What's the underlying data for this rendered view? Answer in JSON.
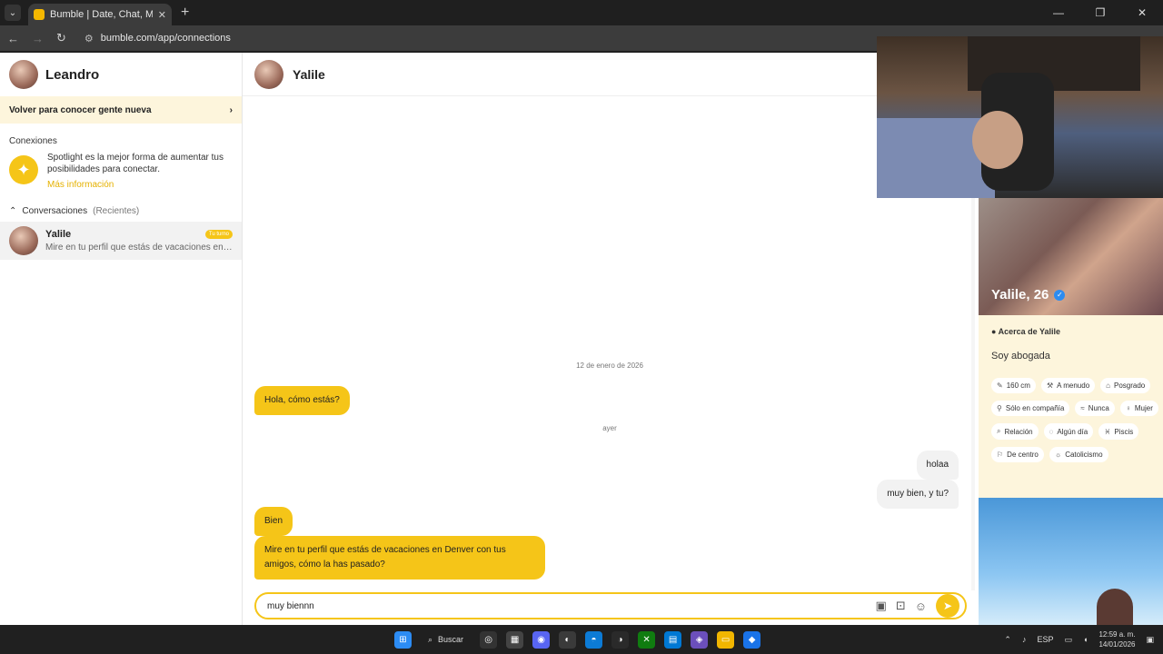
{
  "browser": {
    "tab_title": "Bumble | Date, Chat, Meet New",
    "url": "bumble.com/app/connections"
  },
  "sidebar": {
    "username": "Leandro",
    "meet_new_label": "Volver para conocer gente nueva",
    "connections_label": "Conexiones",
    "spotlight_text": "Spotlight es la mejor forma de aumentar tus posibilidades para conectar.",
    "spotlight_link": "Más información",
    "conversations_label": "Conversaciones",
    "recent_label": "(Recientes)",
    "conversations": [
      {
        "name": "Yalile",
        "badge": "Tu turno",
        "preview": "Mire en tu perfil que estás de vacaciones en ..."
      }
    ]
  },
  "chat": {
    "contact_name": "Yalile",
    "date1": "12 de enero de 2026",
    "date2": "ayer",
    "messages": [
      {
        "text": "Hola, cómo estás?",
        "dir": "in"
      },
      {
        "text": "holaa",
        "dir": "out"
      },
      {
        "text": "muy bien, y tu?",
        "dir": "out"
      },
      {
        "text": "Bien",
        "dir": "in"
      },
      {
        "text": "Mire en tu perfil que estás de vacaciones en Denver con tus amigos, cómo la has pasado?",
        "dir": "in"
      }
    ],
    "composer_value": "muy biennn"
  },
  "profile": {
    "name_age": "Yalile, 26",
    "about_title": "Acerca de Yalile",
    "bio": "Soy abogada",
    "tags": [
      {
        "icon": "ruler-icon",
        "label": "160 cm"
      },
      {
        "icon": "exercise-icon",
        "label": "A menudo"
      },
      {
        "icon": "education-icon",
        "label": "Posgrado"
      },
      {
        "icon": "drink-icon",
        "label": "Sólo en compañía"
      },
      {
        "icon": "smoke-icon",
        "label": "Nunca"
      },
      {
        "icon": "gender-icon",
        "label": "Mujer"
      },
      {
        "icon": "search-icon",
        "label": "Relación"
      },
      {
        "icon": "ring-icon",
        "label": "Algún día"
      },
      {
        "icon": "zodiac-icon",
        "label": "Piscis"
      },
      {
        "icon": "politics-icon",
        "label": "De centro"
      },
      {
        "icon": "religion-icon",
        "label": "Catolicismo"
      }
    ]
  },
  "taskbar": {
    "search_label": "Buscar",
    "lang": "ESP",
    "time": "12:59 a. m.",
    "date": "14/01/2026"
  },
  "colors": {
    "accent": "#f5c518",
    "profile_bg": "#fdf5dc"
  }
}
